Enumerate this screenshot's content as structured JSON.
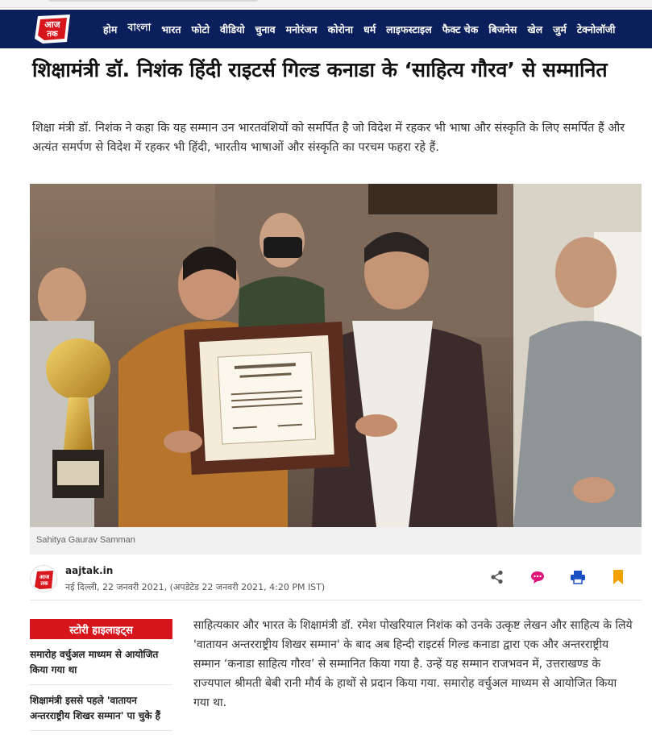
{
  "nav": {
    "items": [
      "होम",
      "বাংলা",
      "भारत",
      "फोटो",
      "वीडियो",
      "चुनाव",
      "मनोरंजन",
      "कोरोना",
      "धर्म",
      "लाइफस्टाइल",
      "फैक्ट चेक",
      "बिजनेस",
      "खेल",
      "जुर्म",
      "टेक्नोलॉजी"
    ],
    "logo_text": "आज तक"
  },
  "article": {
    "headline": "शिक्षामंत्री डॉ. निशंक हिंदी राइटर्स गिल्ड कनाडा के ‘साहित्य गौरव’ से सम्मानित",
    "summary": "शिक्षा मंत्री डॉ. निशंक ने कहा कि यह सम्मान उन भारतवंशियों को समर्पित है जो विदेश में रहकर भी भाषा और संस्कृति के लिए समर्पित हैं और अत्यंत समर्पण से विदेश में रहकर भी हिंदी, भारतीय भाषाओं और संस्कृति का परचम फहरा रहे हैं.",
    "photo_caption": "Sahitya Gaurav Samman",
    "source": "aajtak.in",
    "dateline": "नई दिल्ली, 22 जनवरी 2021, (अपडेटेड 22 जनवरी 2021, 4:20 PM IST)",
    "body": "साहित्यकार और भारत के शिक्षामंत्री डॉ. रमेश पोखरियाल निशंक को उनके उत्कृष्ट लेखन और साहित्य के लिये 'वातायन अन्तरराष्ट्रीय शिखर सम्मान' के बाद अब हिन्दी राइटर्स गिल्ड कनाडा द्वारा एक और अन्तरराष्ट्रीय सम्मान ‘कनाडा साहित्य गौरव’ से सम्मानित किया गया है. उन्हें यह सम्मान राजभवन में, उत्तराखण्ड के राज्यपाल श्रीमती बेबी रानी मौर्य के हाथों से प्रदान किया गया. समारोह वर्चुअल माध्यम से आयोजित किया गया था."
  },
  "highlights": {
    "title": "स्टोरी हाइलाइट्स",
    "items": [
      "समारोह वर्चुअल माध्यम से आयोजित किया गया था",
      "शिक्षामंत्री इससे पहले 'वातायन अन्तरराष्ट्रीय शिखर सम्मान' पा चुके हैं"
    ]
  },
  "colors": {
    "nav_bg": "#0b1f5c",
    "brand_red": "#d7151c",
    "share_icon": "#555555",
    "comment_icon": "#e0147a",
    "print_icon": "#1a4fc4",
    "bookmark_icon": "#f2a200"
  },
  "icons": [
    "share-icon",
    "comment-icon",
    "print-icon",
    "bookmark-icon"
  ]
}
